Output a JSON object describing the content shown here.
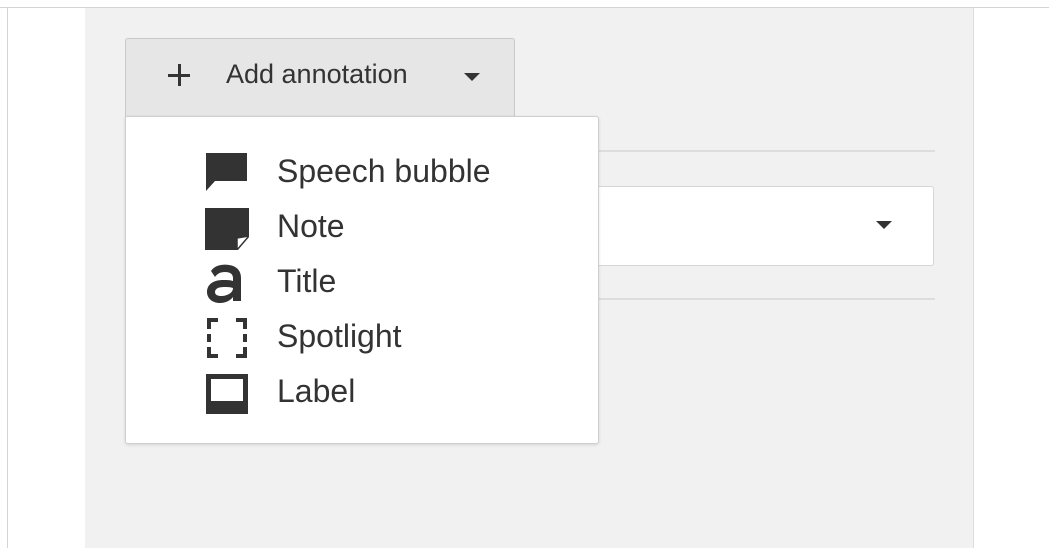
{
  "toolbar": {
    "add_annotation_label": "Add annotation",
    "plus_icon": "plus-icon",
    "caret_icon": "caret-down-icon"
  },
  "annotation_menu": {
    "items": [
      {
        "label": "Speech bubble",
        "icon": "speech-bubble-icon"
      },
      {
        "label": "Note",
        "icon": "note-icon"
      },
      {
        "label": "Title",
        "icon": "title-icon"
      },
      {
        "label": "Spotlight",
        "icon": "spotlight-icon"
      },
      {
        "label": "Label",
        "icon": "label-icon"
      }
    ]
  },
  "colors": {
    "panel_background": "#f1f1f1",
    "button_background": "#e6e6e6",
    "icon_color": "#333333"
  }
}
